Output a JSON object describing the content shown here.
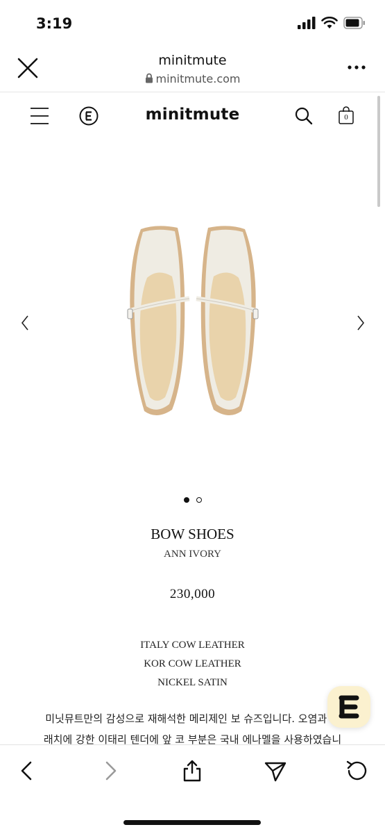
{
  "status_bar": {
    "time": "3:19"
  },
  "browser": {
    "site_title": "minitmute",
    "url": "minitmute.com"
  },
  "site_nav": {
    "brand": "minitmute",
    "cart_count": "0"
  },
  "product": {
    "name": "BOW SHOES",
    "color": "ANN IVORY",
    "price": "230,000",
    "image_count": 2,
    "active_image": 1,
    "materials": [
      "ITALY COW LEATHER",
      "KOR COW LEATHER",
      "NICKEL SATIN"
    ],
    "description": [
      "미닛뮤트만의 감성으로 재해석한 메리제인 보 슈즈입니다. 오염과 스",
      "래치에 강한 이태리 텐더에 앞 코 부분은 국내 에나멜을 사용하였습니"
    ]
  },
  "floating_badge": {
    "letter": "E"
  },
  "icons": {
    "close": "close-icon",
    "more": "more-icon",
    "menu": "menu-icon",
    "e_logo": "e-logo-icon",
    "search": "search-icon",
    "cart": "cart-icon",
    "prev": "chevron-left-icon",
    "next": "chevron-right-icon",
    "back": "back-icon",
    "forward": "forward-icon",
    "share": "share-icon",
    "send": "send-icon",
    "reload": "reload-icon"
  },
  "colors": {
    "badge_bg": "#fbf1cf",
    "text": "#111111"
  }
}
